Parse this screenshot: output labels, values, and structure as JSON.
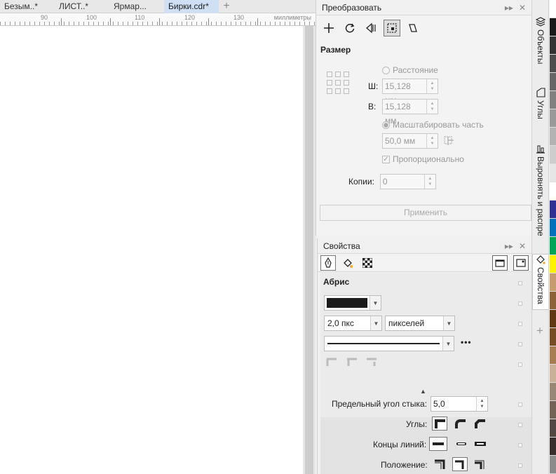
{
  "tabs": [
    {
      "label": "Безым..*",
      "active": false
    },
    {
      "label": "ЛИСТ..*",
      "active": false
    },
    {
      "label": "Ярмар...",
      "active": false
    },
    {
      "label": "Бирки.cdr*",
      "active": true
    }
  ],
  "tab_add": "+",
  "ruler": {
    "labels": [
      "90",
      "100",
      "110",
      "120",
      "130"
    ],
    "units": "миллиметры"
  },
  "transform": {
    "title": "Преобразовать",
    "section": "Размер",
    "distance_label": "Расстояние",
    "w_label": "Ш:",
    "w_value": "15,128 мм",
    "h_label": "В:",
    "h_value": "15,128 мм",
    "scale_part_label": "Масштабировать часть",
    "part_value": "50,0 мм",
    "proportional_label": "Пропорционально",
    "copies_label": "Копии:",
    "copies_value": "0",
    "apply_label": "Применить"
  },
  "properties": {
    "title": "Свойства",
    "section": "Абрис",
    "outline_color": "#1c1c1c",
    "width_value": "2,0 пкс",
    "units_value": "пикселей",
    "more": "•••",
    "miter_label": "Предельный угол стыка:",
    "miter_value": "5,0",
    "corners_label": "Углы:",
    "caps_label": "Концы линий:",
    "position_label": "Положение:"
  },
  "side_tabs": [
    {
      "label": "Объекты"
    },
    {
      "label": "Углы"
    },
    {
      "label": "Выровнять и распре"
    },
    {
      "label": "Свойства"
    }
  ],
  "palette": [
    "#ffffff",
    "#1a1a1a",
    "#333333",
    "#4d4d4d",
    "#666666",
    "#808080",
    "#999999",
    "#b3b3b3",
    "#cccccc",
    "#e6e6e6",
    "#ffffff",
    "#2e3192",
    "#0072bc",
    "#00a651",
    "#fff200",
    "#c69c6d",
    "#8c6239",
    "#603913",
    "#754c24",
    "#a67c52",
    "#c7b299",
    "#998675",
    "#736357",
    "#534741",
    "#362f2d",
    "#8b8b8b"
  ]
}
